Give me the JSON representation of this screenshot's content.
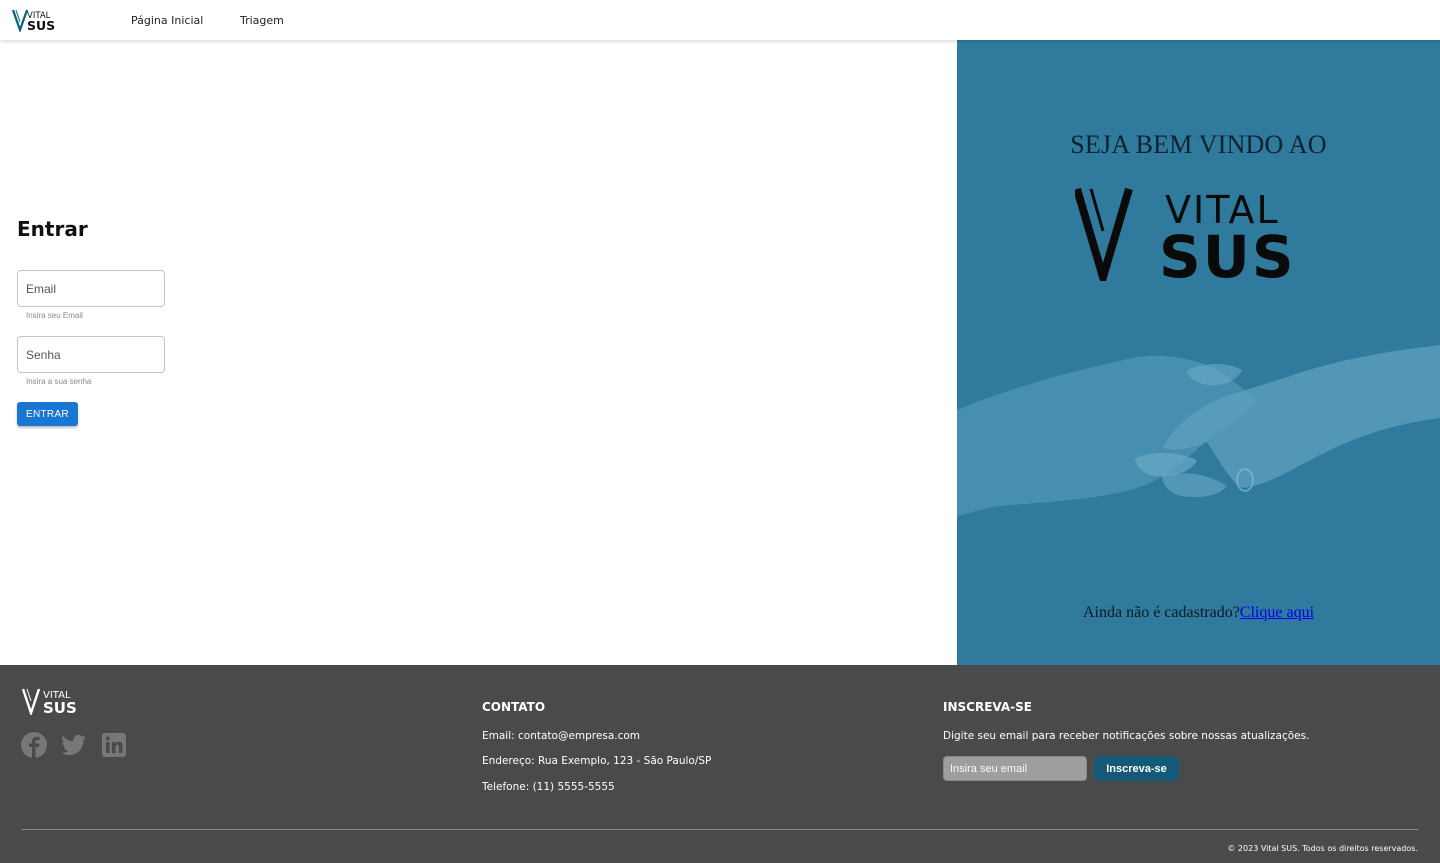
{
  "navbar": {
    "logo_top": "VITAL",
    "logo_bottom": "SUS",
    "links": [
      "Página Inicial",
      "Triagem"
    ]
  },
  "login": {
    "title": "Entrar",
    "email_placeholder": "Email",
    "email_helper": "Insira seu Email",
    "password_placeholder": "Senha",
    "password_helper": "Insira a sua senha",
    "submit_label": "ENTRAR"
  },
  "hero": {
    "title": "SEJA BEM VINDO AO",
    "logo_top": "VITAL",
    "logo_bottom": "SUS",
    "signup_text": "Ainda não é cadastrado?",
    "signup_link": "Clique aqui"
  },
  "footer": {
    "logo_top": "VITAL",
    "logo_bottom": "SUS",
    "social_icons": [
      "facebook-icon",
      "twitter-icon",
      "linkedin-icon"
    ],
    "contact": {
      "heading": "CONTATO",
      "email": "Email: contato@empresa.com",
      "address": "Endereço: Rua Exemplo, 123 - São Paulo/SP",
      "phone": "Telefone: (11) 5555-5555"
    },
    "subscribe": {
      "heading": "INSCREVA-SE",
      "description": "Digite seu email para receber notificações sobre nossas atualizações.",
      "input_placeholder": "Insira seu email",
      "button_label": "Inscreva-se"
    },
    "copyright": "© 2023 Vital SUS. Todos os direitos reservados."
  },
  "colors": {
    "primary_button": "#1976d2",
    "hero_background": "#2f7a9d",
    "footer_background": "#4a4a4a",
    "subscribe_button": "#145a78"
  }
}
